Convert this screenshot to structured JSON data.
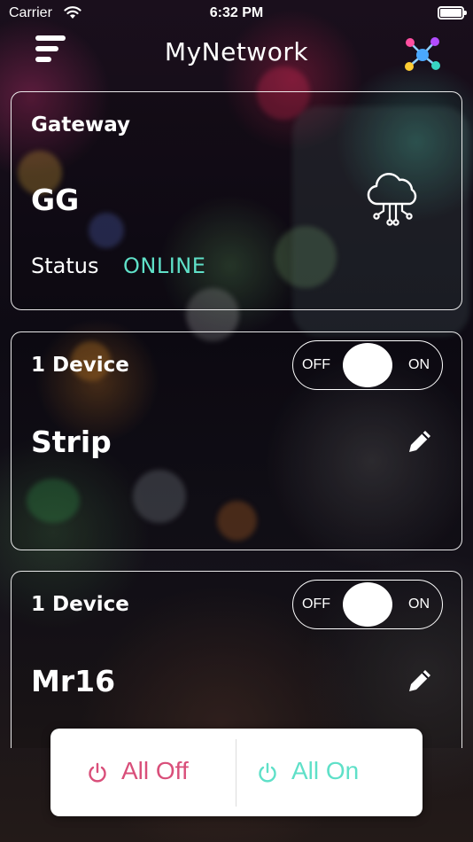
{
  "status_bar": {
    "carrier": "Carrier",
    "time": "6:32 PM"
  },
  "header": {
    "title": "MyNetwork"
  },
  "gateway": {
    "label": "Gateway",
    "name": "GG",
    "status_label": "Status",
    "status_value": "ONLINE",
    "status_color": "#5fe0c8"
  },
  "groups": [
    {
      "device_count": "1 Device",
      "name": "Strip",
      "toggle_off": "OFF",
      "toggle_on": "ON"
    },
    {
      "device_count": "1 Device",
      "name": "Mr16",
      "toggle_off": "OFF",
      "toggle_on": "ON"
    }
  ],
  "bottom_bar": {
    "all_off_label": "All Off",
    "all_on_label": "All On",
    "off_color": "#d94f7a",
    "on_color": "#5fe0c8"
  },
  "icons": [
    "wifi-icon",
    "battery-icon",
    "menu-icon",
    "network-nodes-icon",
    "cloud-circuit-icon",
    "pencil-icon",
    "power-icon"
  ]
}
